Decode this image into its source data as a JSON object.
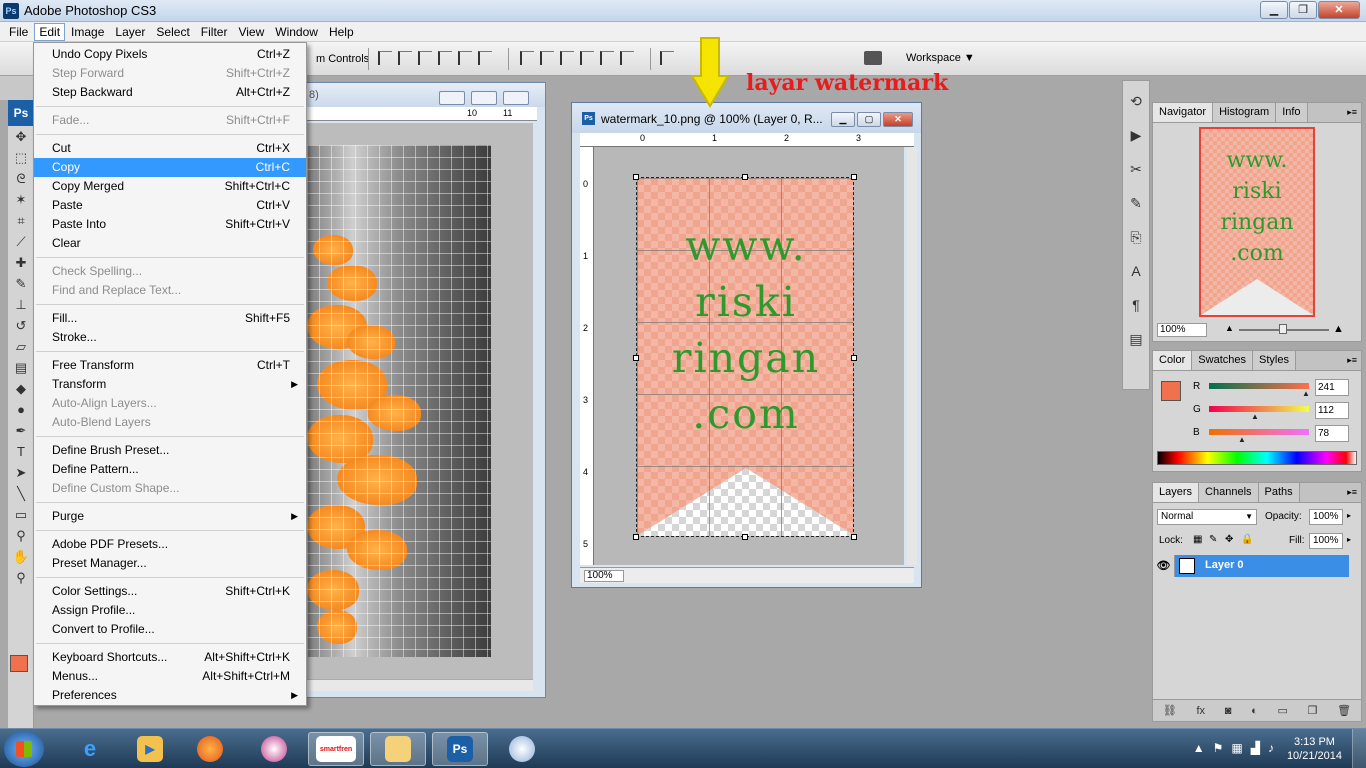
{
  "window": {
    "title": "Adobe Photoshop CS3"
  },
  "menubar": [
    "File",
    "Edit",
    "Image",
    "Layer",
    "Select",
    "Filter",
    "View",
    "Window",
    "Help"
  ],
  "options_bar": {
    "controls_text": "m Controls",
    "workspace_label": "Workspace"
  },
  "edit_menu": {
    "groups": [
      [
        {
          "label": "Undo Copy Pixels",
          "shortcut": "Ctrl+Z",
          "enabled": true
        },
        {
          "label": "Step Forward",
          "shortcut": "Shift+Ctrl+Z",
          "enabled": false
        },
        {
          "label": "Step Backward",
          "shortcut": "Alt+Ctrl+Z",
          "enabled": true
        }
      ],
      [
        {
          "label": "Fade...",
          "shortcut": "Shift+Ctrl+F",
          "enabled": false
        }
      ],
      [
        {
          "label": "Cut",
          "shortcut": "Ctrl+X",
          "enabled": true
        },
        {
          "label": "Copy",
          "shortcut": "Ctrl+C",
          "enabled": true,
          "highlighted": true
        },
        {
          "label": "Copy Merged",
          "shortcut": "Shift+Ctrl+C",
          "enabled": true
        },
        {
          "label": "Paste",
          "shortcut": "Ctrl+V",
          "enabled": true
        },
        {
          "label": "Paste Into",
          "shortcut": "Shift+Ctrl+V",
          "enabled": true
        },
        {
          "label": "Clear",
          "shortcut": "",
          "enabled": true
        }
      ],
      [
        {
          "label": "Check Spelling...",
          "shortcut": "",
          "enabled": false
        },
        {
          "label": "Find and Replace Text...",
          "shortcut": "",
          "enabled": false
        }
      ],
      [
        {
          "label": "Fill...",
          "shortcut": "Shift+F5",
          "enabled": true
        },
        {
          "label": "Stroke...",
          "shortcut": "",
          "enabled": true
        }
      ],
      [
        {
          "label": "Free Transform",
          "shortcut": "Ctrl+T",
          "enabled": true
        },
        {
          "label": "Transform",
          "shortcut": "",
          "enabled": true,
          "submenu": true
        },
        {
          "label": "Auto-Align Layers...",
          "shortcut": "",
          "enabled": false
        },
        {
          "label": "Auto-Blend Layers",
          "shortcut": "",
          "enabled": false
        }
      ],
      [
        {
          "label": "Define Brush Preset...",
          "shortcut": "",
          "enabled": true
        },
        {
          "label": "Define Pattern...",
          "shortcut": "",
          "enabled": true
        },
        {
          "label": "Define Custom Shape...",
          "shortcut": "",
          "enabled": false
        }
      ],
      [
        {
          "label": "Purge",
          "shortcut": "",
          "enabled": true,
          "submenu": true
        }
      ],
      [
        {
          "label": "Adobe PDF Presets...",
          "shortcut": "",
          "enabled": true
        },
        {
          "label": "Preset Manager...",
          "shortcut": "",
          "enabled": true
        }
      ],
      [
        {
          "label": "Color Settings...",
          "shortcut": "Shift+Ctrl+K",
          "enabled": true
        },
        {
          "label": "Assign Profile...",
          "shortcut": "",
          "enabled": true
        },
        {
          "label": "Convert to Profile...",
          "shortcut": "",
          "enabled": true
        }
      ],
      [
        {
          "label": "Keyboard Shortcuts...",
          "shortcut": "Alt+Shift+Ctrl+K",
          "enabled": true
        },
        {
          "label": "Menus...",
          "shortcut": "Alt+Shift+Ctrl+M",
          "enabled": true
        },
        {
          "label": "Preferences",
          "shortcut": "",
          "enabled": true,
          "submenu": true
        }
      ]
    ]
  },
  "doc1": {
    "title_fragment": "8)",
    "ruler_labels": [
      "10",
      "11"
    ]
  },
  "doc2": {
    "title": "watermark_10.png @ 100% (Layer 0, R...",
    "zoom": "100%",
    "hruler": [
      "0",
      "1",
      "2",
      "3"
    ],
    "vruler": [
      "0",
      "1",
      "2",
      "3",
      "4",
      "5"
    ],
    "watermark_lines": [
      "www.",
      "riski",
      "ringan",
      ".com"
    ]
  },
  "annotation": {
    "label": "layar watermark",
    "arrow_color": "#f5e400",
    "label_color": "#e81c1c"
  },
  "navigator": {
    "tabs": [
      "Navigator",
      "Histogram",
      "Info"
    ],
    "zoom": "100%",
    "thumb_lines": [
      "www.",
      "riski",
      "ringan",
      ".com"
    ]
  },
  "color_panel": {
    "tabs": [
      "Color",
      "Swatches",
      "Styles"
    ],
    "foreground": "#f1704e",
    "channels": [
      {
        "label": "R",
        "value": "241"
      },
      {
        "label": "G",
        "value": "112"
      },
      {
        "label": "B",
        "value": "78"
      }
    ]
  },
  "layers_panel": {
    "tabs": [
      "Layers",
      "Channels",
      "Paths"
    ],
    "blend_mode": "Normal",
    "opacity_label": "Opacity:",
    "opacity": "100%",
    "lock_label": "Lock:",
    "fill_label": "Fill:",
    "fill": "100%",
    "layer_name": "Layer 0"
  },
  "taskbar": {
    "time": "3:13 PM",
    "date": "10/21/2014",
    "ps_label": "Ps",
    "smartfren_label": "smartfren"
  }
}
